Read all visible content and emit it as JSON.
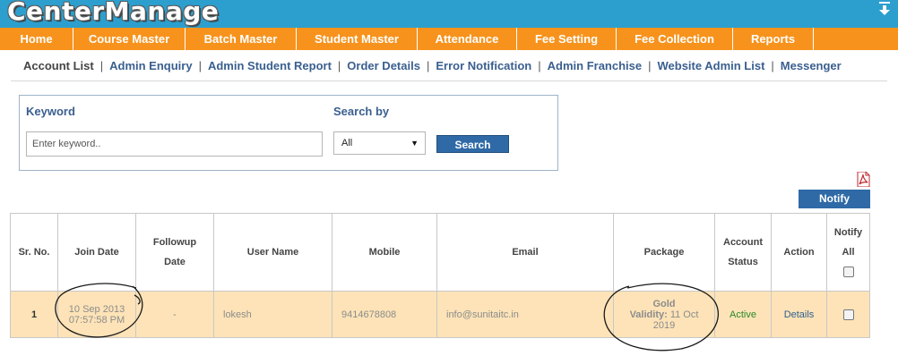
{
  "app": {
    "logo_text": "CenterManage"
  },
  "main_nav": [
    {
      "label": "Home"
    },
    {
      "label": "Course Master"
    },
    {
      "label": "Batch Master"
    },
    {
      "label": "Student Master"
    },
    {
      "label": "Attendance"
    },
    {
      "label": "Fee Setting"
    },
    {
      "label": "Fee Collection"
    },
    {
      "label": "Reports"
    }
  ],
  "sub_nav": [
    {
      "label": "Account List"
    },
    {
      "label": "Admin Enquiry"
    },
    {
      "label": "Admin Student Report"
    },
    {
      "label": "Order Details"
    },
    {
      "label": "Error Notification"
    },
    {
      "label": "Admin Franchise"
    },
    {
      "label": "Website Admin List"
    },
    {
      "label": "Messenger"
    }
  ],
  "search": {
    "keyword_label": "Keyword",
    "keyword_placeholder": "Enter keyword..",
    "keyword_value": "",
    "searchby_label": "Search by",
    "searchby_selected": "All",
    "search_button": "Search"
  },
  "notify_button": "Notify",
  "table": {
    "headers": {
      "sr_no": "Sr. No.",
      "join_date": "Join Date",
      "followup_1": "Followup",
      "followup_2": "Date",
      "user_name": "User Name",
      "mobile": "Mobile",
      "email": "Email",
      "package": "Package",
      "account_1": "Account",
      "account_2": "Status",
      "action": "Action",
      "notify_1": "Notify",
      "notify_2": "All"
    },
    "rows": [
      {
        "sr_no": "1",
        "join_date_1": "10 Sep 2013",
        "join_date_2": "07:57:58 PM",
        "followup_date": "-",
        "user_name": "lokesh",
        "mobile": "9414678808",
        "email": "info@sunitaitc.in",
        "package_name": "Gold",
        "validity_label": "Validity:",
        "validity_date_1": "11 Oct",
        "validity_date_2": "2019",
        "account_status": "Active",
        "action": "Details"
      }
    ]
  }
}
